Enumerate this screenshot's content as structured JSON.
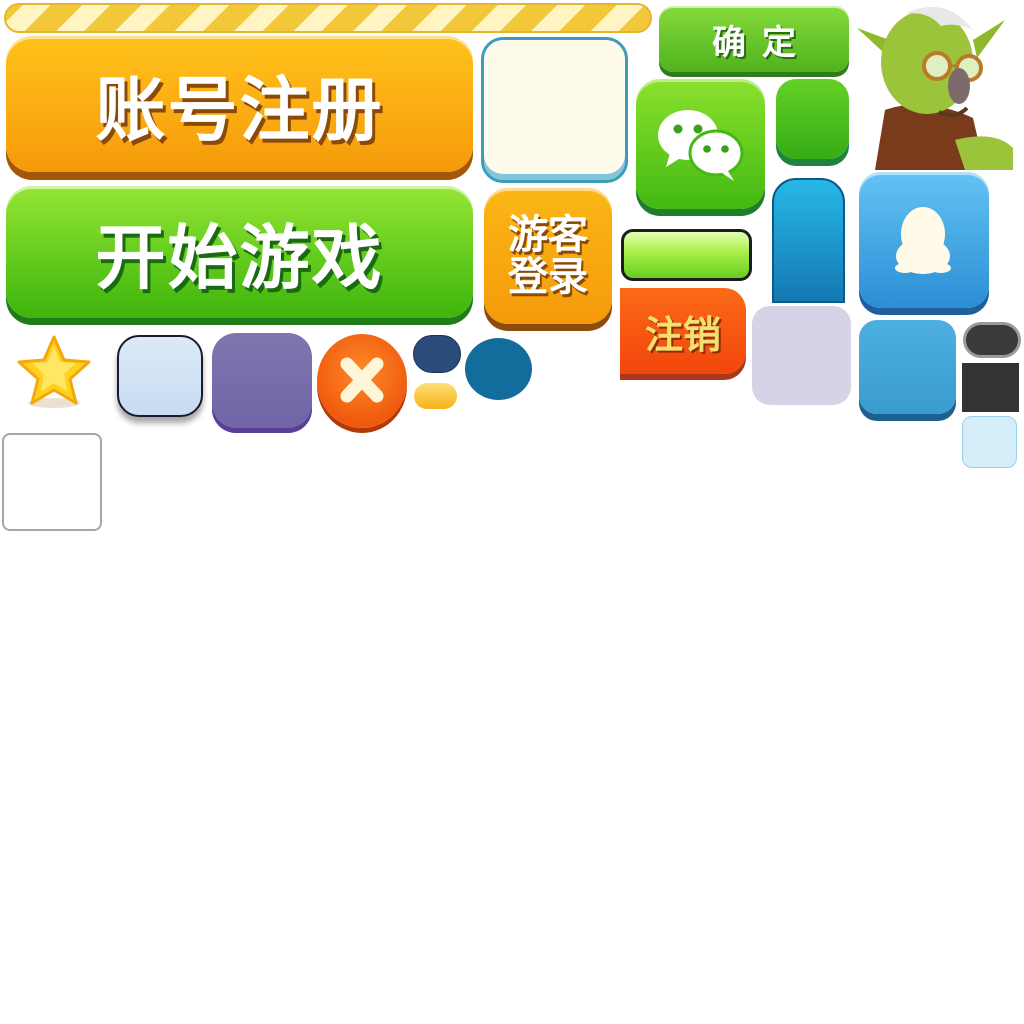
{
  "progress": {
    "fill_fraction": 1.0
  },
  "buttons": {
    "register": "账号注册",
    "start_game": "开始游戏",
    "guest_login_line1": "游客",
    "guest_login_line2": "登录",
    "confirm": "确定",
    "logout": "注销"
  },
  "icons": [
    "wechat-icon",
    "qq-icon",
    "star-icon",
    "close-icon",
    "goblin-character"
  ],
  "colors": {
    "orange": "#f7a512",
    "green": "#56c21a",
    "blue": "#2b8ed4",
    "red_orange": "#f2460c",
    "purple": "#7468aa",
    "yellow_stripe": "#f3c73a"
  }
}
